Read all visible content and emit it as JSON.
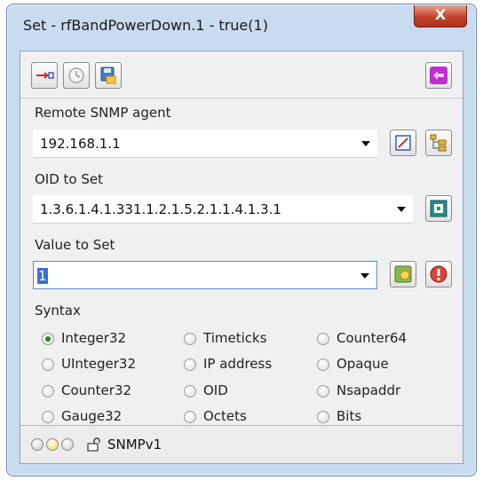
{
  "window": {
    "title": "Set - rfBandPowerDown.1 - true(1)",
    "close_label": "X"
  },
  "toolbar": {
    "buttons": [
      {
        "name": "connect-icon"
      },
      {
        "name": "clock-icon"
      },
      {
        "name": "save-icon"
      },
      {
        "name": "switch-icon"
      }
    ]
  },
  "agent": {
    "label": "Remote SNMP agent",
    "value": "192.168.1.1"
  },
  "oid": {
    "label": "OID to Set",
    "value": "1.3.6.1.4.1.331.1.2.1.5.2.1.1.4.1.3.1"
  },
  "set_value": {
    "label": "Value to Set",
    "value": "1"
  },
  "syntax": {
    "label": "Syntax",
    "selected": "Integer32",
    "options": [
      [
        "Integer32",
        "Timeticks",
        "Counter64"
      ],
      [
        "UInteger32",
        "IP address",
        "Opaque"
      ],
      [
        "Counter32",
        "OID",
        "Nsapaddr"
      ],
      [
        "Gauge32",
        "Octets",
        "Bits"
      ]
    ]
  },
  "status": {
    "version": "SNMPv1",
    "leds": [
      "#c9c9c9",
      "#f2d43a",
      "#c9c9c9"
    ]
  },
  "colors": {
    "window_frame": "#c8dbef",
    "client_bg": "#f0f0f0",
    "close_button": "#c2432b",
    "selected_radio": "#2d7d2d"
  }
}
